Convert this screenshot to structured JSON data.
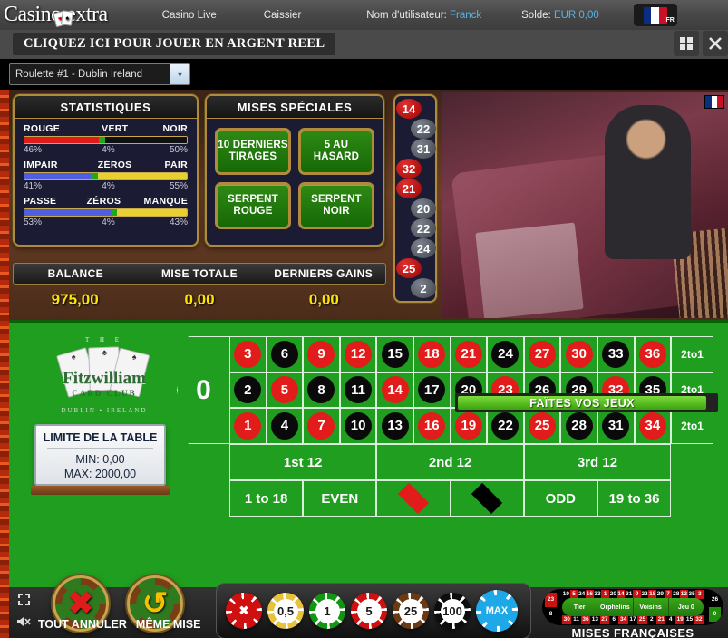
{
  "header": {
    "brand": "Casino extra",
    "nav": [
      "Casino Live",
      "Caissier"
    ],
    "username_label": "Nom d'utilisateur:",
    "username_value": "Franck",
    "balance_label": "Solde:",
    "balance_value": "EUR 0,00",
    "flag_code": "FR",
    "cta": "CLIQUEZ ICI POUR JOUER EN ARGENT REEL",
    "tile_icon": "grid-icon",
    "close_icon": "close-icon"
  },
  "game_select": {
    "value": "Roulette #1 - Dublin Ireland",
    "options": [
      "Roulette #1 - Dublin Ireland"
    ],
    "arrow_icon": "chevron-down-icon"
  },
  "stats": {
    "title": "STATISTIQUES",
    "rows": [
      {
        "left_label": "ROUGE",
        "mid_label": "VERT",
        "right_label": "NOIR",
        "left_pct": "46%",
        "mid_pct": "4%",
        "right_pct": "50%",
        "left_value": 46,
        "mid_value": 4,
        "right_value": 50,
        "left_color": "#e01b1b",
        "mid_color": "#1fa81f",
        "right_color": "#111111"
      },
      {
        "left_label": "IMPAIR",
        "mid_label": "ZÉROS",
        "right_label": "PAIR",
        "left_pct": "41%",
        "mid_pct": "4%",
        "right_pct": "55%",
        "left_value": 41,
        "mid_value": 4,
        "right_value": 55,
        "left_color": "#4f5fe0",
        "mid_color": "#1fa81f",
        "right_color": "#e8d030"
      },
      {
        "left_label": "PASSE",
        "mid_label": "ZÉROS",
        "right_label": "MANQUE",
        "left_pct": "53%",
        "mid_pct": "4%",
        "right_pct": "43%",
        "left_value": 53,
        "mid_value": 4,
        "right_value": 43,
        "left_color": "#4f5fe0",
        "mid_color": "#1fa81f",
        "right_color": "#e8d030"
      }
    ]
  },
  "special": {
    "title": "MISES SPÉCIALES",
    "buttons": [
      {
        "line1": "10 DERNIERS",
        "line2": "TIRAGES"
      },
      {
        "line1": "5 AU",
        "line2": "HASARD"
      },
      {
        "line1": "SERPENT",
        "line2": "ROUGE"
      },
      {
        "line1": "SERPENT",
        "line2": "NOIR"
      }
    ]
  },
  "history": [
    {
      "n": "14",
      "color": "red",
      "side": "left"
    },
    {
      "n": "22",
      "color": "black",
      "side": "right"
    },
    {
      "n": "31",
      "color": "black",
      "side": "right"
    },
    {
      "n": "32",
      "color": "red",
      "side": "left"
    },
    {
      "n": "21",
      "color": "red",
      "side": "left"
    },
    {
      "n": "20",
      "color": "black",
      "side": "right"
    },
    {
      "n": "22",
      "color": "black",
      "side": "right"
    },
    {
      "n": "24",
      "color": "black",
      "side": "right"
    },
    {
      "n": "25",
      "color": "red",
      "side": "left"
    },
    {
      "n": "2",
      "color": "black",
      "side": "right"
    }
  ],
  "balance_bar": {
    "labels": [
      "BALANCE",
      "MISE TOTALE",
      "DERNIERS GAINS"
    ],
    "values": [
      "975,00",
      "0,00",
      "0,00"
    ],
    "value_color": "#ffe400"
  },
  "video": {
    "status_banner": "FAÏTES VOS JEUX",
    "flag_icon": "france-flag-icon"
  },
  "club_logo": {
    "the": "T H E",
    "name": "Fitzwilliam",
    "sub": "CARD CLUB",
    "location": "DUBLIN  •  IRELAND"
  },
  "table_limit": {
    "title": "LIMITE DE LA TABLE",
    "min_label": "MIN:",
    "min_value": "0,00",
    "max_label": "MAX:",
    "max_value": "2000,00"
  },
  "board": {
    "zero": "0",
    "rows": [
      [
        {
          "n": "3",
          "c": "red"
        },
        {
          "n": "6",
          "c": "black"
        },
        {
          "n": "9",
          "c": "red"
        },
        {
          "n": "12",
          "c": "red"
        },
        {
          "n": "15",
          "c": "black"
        },
        {
          "n": "18",
          "c": "red"
        },
        {
          "n": "21",
          "c": "red"
        },
        {
          "n": "24",
          "c": "black"
        },
        {
          "n": "27",
          "c": "red"
        },
        {
          "n": "30",
          "c": "red"
        },
        {
          "n": "33",
          "c": "black"
        },
        {
          "n": "36",
          "c": "red"
        }
      ],
      [
        {
          "n": "2",
          "c": "black"
        },
        {
          "n": "5",
          "c": "red"
        },
        {
          "n": "8",
          "c": "black"
        },
        {
          "n": "11",
          "c": "black"
        },
        {
          "n": "14",
          "c": "red"
        },
        {
          "n": "17",
          "c": "black"
        },
        {
          "n": "20",
          "c": "black"
        },
        {
          "n": "23",
          "c": "red"
        },
        {
          "n": "26",
          "c": "black"
        },
        {
          "n": "29",
          "c": "black"
        },
        {
          "n": "32",
          "c": "red"
        },
        {
          "n": "35",
          "c": "black"
        }
      ],
      [
        {
          "n": "1",
          "c": "red"
        },
        {
          "n": "4",
          "c": "black"
        },
        {
          "n": "7",
          "c": "red"
        },
        {
          "n": "10",
          "c": "black"
        },
        {
          "n": "13",
          "c": "black"
        },
        {
          "n": "16",
          "c": "red"
        },
        {
          "n": "19",
          "c": "red"
        },
        {
          "n": "22",
          "c": "black"
        },
        {
          "n": "25",
          "c": "red"
        },
        {
          "n": "28",
          "c": "black"
        },
        {
          "n": "31",
          "c": "black"
        },
        {
          "n": "34",
          "c": "red"
        }
      ]
    ],
    "columns_label": [
      "2to1",
      "2to1",
      "2to1"
    ],
    "dozens": [
      "1st 12",
      "2nd 12",
      "3rd 12"
    ],
    "outside": [
      {
        "type": "text",
        "label": "1 to 18"
      },
      {
        "type": "text",
        "label": "EVEN"
      },
      {
        "type": "diamond",
        "color": "red",
        "label": ""
      },
      {
        "type": "diamond",
        "color": "black",
        "label": ""
      },
      {
        "type": "text",
        "label": "ODD"
      },
      {
        "type": "text",
        "label": "19 to 36"
      }
    ]
  },
  "bottom": {
    "cancel_label": "TOUT ANNULER",
    "repeat_label": "MÊME MISE",
    "cancel_glyph": "✖",
    "repeat_glyph": "↺",
    "fullscreen_icon": "fullscreen-icon",
    "sound_icon": "sound-mute-icon",
    "chips": [
      {
        "label": "✖",
        "face": "#ffffff",
        "ring": "#d01010",
        "text": "#ffffff",
        "kind": "clear"
      },
      {
        "label": "0,5",
        "face": "#ffffff",
        "ring": "#e8c23c",
        "text": "#1a1a1a",
        "kind": "value"
      },
      {
        "label": "1",
        "face": "#ffffff",
        "ring": "#129612",
        "text": "#1a1a1a",
        "kind": "value"
      },
      {
        "label": "5",
        "face": "#ffffff",
        "ring": "#d01010",
        "text": "#1a1a1a",
        "kind": "value"
      },
      {
        "label": "25",
        "face": "#ffffff",
        "ring": "#6b3a14",
        "text": "#1a1a1a",
        "kind": "value"
      },
      {
        "label": "100",
        "face": "#ffffff",
        "ring": "#0d0d0d",
        "text": "#1a1a1a",
        "kind": "value"
      },
      {
        "label": "MAX",
        "face": "#1fa8e8",
        "ring": "#1fa8e8",
        "text": "#ffffff",
        "kind": "max"
      }
    ]
  },
  "racetrack": {
    "caption": "MISES FRANÇAISES",
    "sections": [
      "Tier",
      "Orphelins",
      "Voisins",
      "Jeu 0"
    ],
    "top_numbers": [
      {
        "n": "10",
        "c": "black"
      },
      {
        "n": "5",
        "c": "red"
      },
      {
        "n": "24",
        "c": "black"
      },
      {
        "n": "16",
        "c": "red"
      },
      {
        "n": "33",
        "c": "black"
      },
      {
        "n": "1",
        "c": "red"
      },
      {
        "n": "20",
        "c": "black"
      },
      {
        "n": "14",
        "c": "red"
      },
      {
        "n": "31",
        "c": "black"
      },
      {
        "n": "9",
        "c": "red"
      },
      {
        "n": "22",
        "c": "black"
      },
      {
        "n": "18",
        "c": "red"
      },
      {
        "n": "29",
        "c": "black"
      },
      {
        "n": "7",
        "c": "red"
      },
      {
        "n": "28",
        "c": "black"
      },
      {
        "n": "12",
        "c": "red"
      },
      {
        "n": "35",
        "c": "black"
      },
      {
        "n": "3",
        "c": "red"
      }
    ],
    "bottom_numbers": [
      {
        "n": "30",
        "c": "red"
      },
      {
        "n": "11",
        "c": "black"
      },
      {
        "n": "36",
        "c": "red"
      },
      {
        "n": "13",
        "c": "black"
      },
      {
        "n": "27",
        "c": "red"
      },
      {
        "n": "6",
        "c": "black"
      },
      {
        "n": "34",
        "c": "red"
      },
      {
        "n": "17",
        "c": "black"
      },
      {
        "n": "25",
        "c": "red"
      },
      {
        "n": "2",
        "c": "black"
      },
      {
        "n": "21",
        "c": "red"
      },
      {
        "n": "4",
        "c": "black"
      },
      {
        "n": "19",
        "c": "red"
      },
      {
        "n": "15",
        "c": "black"
      },
      {
        "n": "32",
        "c": "red"
      }
    ],
    "left_end": [
      {
        "n": "23",
        "c": "red"
      },
      {
        "n": "8",
        "c": "black"
      }
    ],
    "right_end": [
      {
        "n": "26",
        "c": "black"
      },
      {
        "n": "0",
        "c": "green"
      }
    ]
  }
}
